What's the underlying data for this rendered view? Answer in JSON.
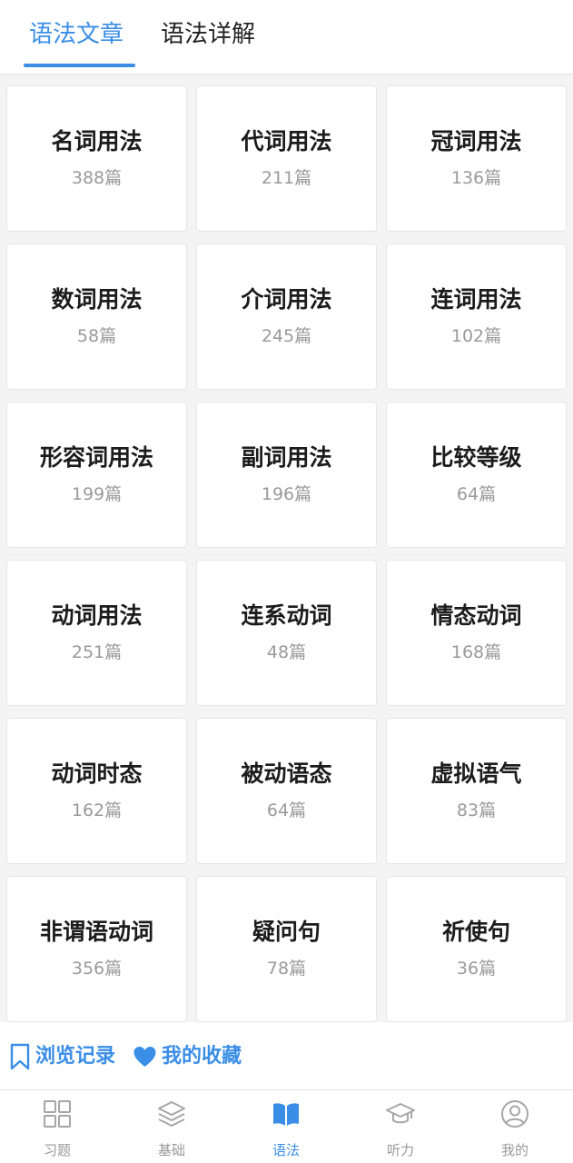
{
  "header": {
    "tabs": [
      {
        "label": "语法文章",
        "active": true
      },
      {
        "label": "语法详解",
        "active": false
      }
    ]
  },
  "categories": [
    {
      "title": "名词用法",
      "count": "388篇"
    },
    {
      "title": "代词用法",
      "count": "211篇"
    },
    {
      "title": "冠词用法",
      "count": "136篇"
    },
    {
      "title": "数词用法",
      "count": "58篇"
    },
    {
      "title": "介词用法",
      "count": "245篇"
    },
    {
      "title": "连词用法",
      "count": "102篇"
    },
    {
      "title": "形容词用法",
      "count": "199篇"
    },
    {
      "title": "副词用法",
      "count": "196篇"
    },
    {
      "title": "比较等级",
      "count": "64篇"
    },
    {
      "title": "动词用法",
      "count": "251篇"
    },
    {
      "title": "连系动词",
      "count": "48篇"
    },
    {
      "title": "情态动词",
      "count": "168篇"
    },
    {
      "title": "动词时态",
      "count": "162篇"
    },
    {
      "title": "被动语态",
      "count": "64篇"
    },
    {
      "title": "虚拟语气",
      "count": "83篇"
    },
    {
      "title": "非谓语动词",
      "count": "356篇"
    },
    {
      "title": "疑问句",
      "count": "78篇"
    },
    {
      "title": "祈使句",
      "count": "36篇"
    }
  ],
  "quick_links": {
    "history": {
      "label": "浏览记录",
      "icon": "bookmark-icon"
    },
    "favorites": {
      "label": "我的收藏",
      "icon": "heart-icon"
    }
  },
  "bottom_nav": [
    {
      "label": "习题",
      "icon": "grid-icon",
      "active": false
    },
    {
      "label": "基础",
      "icon": "layers-icon",
      "active": false
    },
    {
      "label": "语法",
      "icon": "book-icon",
      "active": true
    },
    {
      "label": "听力",
      "icon": "graduation-cap-icon",
      "active": false
    },
    {
      "label": "我的",
      "icon": "user-icon",
      "active": false
    }
  ],
  "colors": {
    "accent": "#3a8ee6",
    "text": "#1c1c1c",
    "muted": "#9a9a9a",
    "background": "#f4f4f4"
  }
}
